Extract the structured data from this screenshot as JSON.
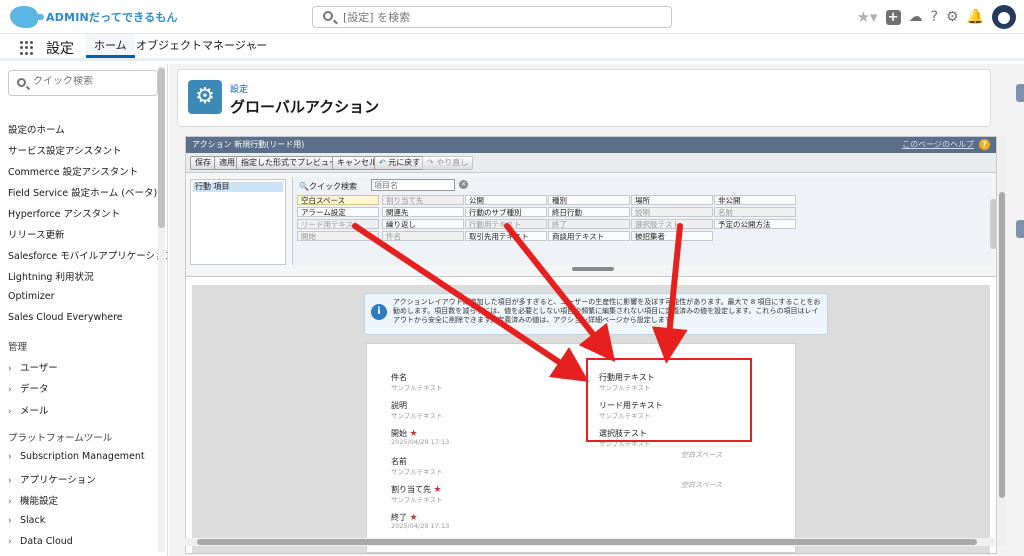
{
  "header": {
    "logo_text": "ADMINだってできるもん",
    "search_placeholder": "[設定] を検索",
    "icons": [
      "favorite-star-icon",
      "plus-icon",
      "cloud-icon",
      "help-icon",
      "gear-icon",
      "bell-icon",
      "avatar"
    ]
  },
  "nav": {
    "app_name": "設定",
    "tabs": [
      {
        "label": "ホーム",
        "active": true
      },
      {
        "label": "オブジェクトマネージャー",
        "active": false
      }
    ]
  },
  "sidebar": {
    "search_placeholder": "クイック検索",
    "items": [
      "設定のホーム",
      "サービス設定アシスタント",
      "Commerce 設定アシスタント",
      "Field Service 設定ホーム (ベータ)",
      "Hyperforce アシスタント",
      "リリース更新",
      "Salesforce モバイルアプリケーション",
      "Lightning 利用状況",
      "Optimizer",
      "Sales Cloud Everywhere"
    ],
    "section_admin": "管理",
    "admin_items": [
      "ユーザー",
      "データ",
      "メール"
    ],
    "section_platform": "プラットフォームツール",
    "platform_items": [
      "Subscription Management",
      "アプリケーション",
      "機能設定",
      "Slack",
      "Data Cloud"
    ]
  },
  "page_header": {
    "breadcrumb": "設定",
    "title": "グローバルアクション"
  },
  "editor": {
    "title": "アクション 新規行動(リード用)",
    "help_link": "このページのヘルプ",
    "toolbar": {
      "save": "保存",
      "apply": "適用",
      "preview": "指定した形式でプレビュー...",
      "cancel": "キャンセル",
      "undo": "元に戻す",
      "redo": "やり直し"
    },
    "palette_left_item": "行動 項目",
    "quick_find_label": "クイック検索",
    "quick_find_placeholder": "項目名",
    "palette_fields": [
      [
        "空白スペース",
        "割り当て先",
        "公開",
        "種別",
        "場所",
        "非公開"
      ],
      [
        "アラーム設定",
        "関連先",
        "行動のサブ種別",
        "終日行動",
        "説明",
        "名前"
      ],
      [
        "リード用テキスト",
        "繰り返し",
        "行動用テキスト",
        "終了",
        "選択肢テスト",
        "予定の公開方法"
      ],
      [
        "開始",
        "件名",
        "取引先用テキスト",
        "商談用テキスト",
        "被招集者",
        ""
      ]
    ],
    "info_text": "アクションレイアウトに追加した項目が多すぎると、ユーザーの生産性に影響を及ぼす可能性があります。最大で 8 項目にすることをお勧めします。項目数を減らすには、値を必要としない項目や頻繁に編集されない項目に定義済みの値を設定します。これらの項目はレイアウトから安全に削除できます。定義済みの値は、アクション詳細ページから設定します。",
    "layout_left": [
      {
        "label": "件名",
        "value": "サンプルテキスト",
        "required": false
      },
      {
        "label": "説明",
        "value": "サンプルテキスト",
        "required": false
      },
      {
        "label": "開始",
        "value": "2025/04/29 17:13",
        "required": true
      },
      {
        "label": "名前",
        "value": "サンプルテキスト",
        "required": false
      },
      {
        "label": "割り当て先",
        "value": "サンプルテキスト",
        "required": true
      },
      {
        "label": "終了",
        "value": "2025/04/29 17:13",
        "required": true
      }
    ],
    "layout_right": [
      {
        "label": "行動用テキスト",
        "value": "サンプルテキスト"
      },
      {
        "label": "リード用テキスト",
        "value": "サンプルテキスト"
      },
      {
        "label": "選択肢テスト",
        "value": "サンプルテキスト"
      }
    ],
    "blank_space": "空白スペース",
    "required_mark": "★"
  },
  "colors": {
    "accent": "#0b5cab",
    "highlight": "#e5201e",
    "titlebar": "#5a6f8a"
  }
}
